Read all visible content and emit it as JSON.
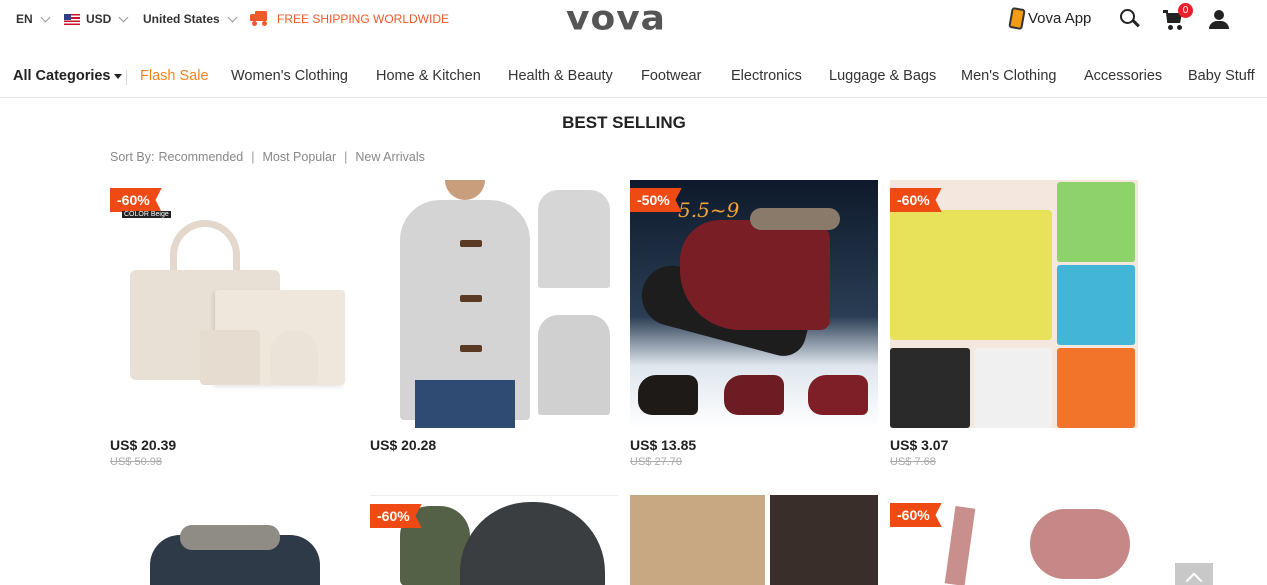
{
  "topbar": {
    "language": "EN",
    "currency": "USD",
    "country": "United States",
    "shipping_notice": "FREE SHIPPING WORLDWIDE",
    "logo": "vova",
    "app_label": "Vova App",
    "cart_count": "0",
    "icons": {
      "flag": "us-flag-icon",
      "truck": "truck-icon",
      "phone": "phone-icon",
      "search": "search-icon",
      "cart": "cart-icon",
      "user": "user-icon"
    }
  },
  "nav": {
    "all_categories": "All Categories",
    "items": [
      "Flash Sale",
      "Women's Clothing",
      "Home & Kitchen",
      "Health & Beauty",
      "Footwear",
      "Electronics",
      "Luggage & Bags",
      "Men's Clothing",
      "Accessories",
      "Baby Stuff"
    ]
  },
  "section": {
    "title": "BEST SELLING",
    "sort_label": "Sort By:",
    "sort_options": [
      "Recommended",
      "Most Popular",
      "New Arrivals"
    ]
  },
  "products": [
    {
      "badge": "-60%",
      "price": "US$ 20.39",
      "old_price": "US$ 50.98",
      "image_text": "COLOR Beige"
    },
    {
      "badge": "",
      "price": "US$ 20.28",
      "old_price": ""
    },
    {
      "badge": "-50%",
      "price": "US$ 13.85",
      "old_price": "US$ 27.70",
      "image_text": "5.5~9"
    },
    {
      "badge": "-60%",
      "price": "US$ 3.07",
      "old_price": "US$ 7.68"
    },
    {
      "badge": "",
      "price": "",
      "old_price": ""
    },
    {
      "badge": "-60%",
      "price": "",
      "old_price": ""
    },
    {
      "badge": "",
      "price": "",
      "old_price": ""
    },
    {
      "badge": "-60%",
      "price": "",
      "old_price": ""
    }
  ],
  "colors": {
    "accent": "#f05a2b",
    "flash_sale": "#f5841f",
    "badge": "#f04a14",
    "cart_badge": "#e8202a"
  }
}
